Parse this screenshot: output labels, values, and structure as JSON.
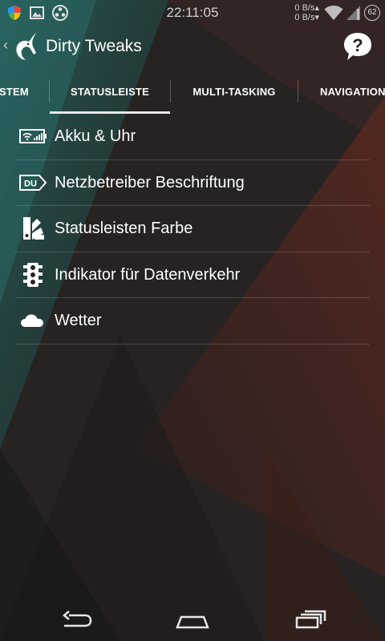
{
  "status_bar": {
    "time": "22:11:05",
    "net_up": "0 B/s",
    "net_down": "0 B/s",
    "battery": "62",
    "icons": [
      "shield-icon",
      "image-icon",
      "media-icon",
      "wifi-icon",
      "signal-icon",
      "battery-icon"
    ]
  },
  "action_bar": {
    "title": "Dirty Tweaks",
    "back_glyph": "‹",
    "help_icon": "help-icon"
  },
  "tabs": [
    {
      "label": "STEM"
    },
    {
      "label": "STATUSLEISTE",
      "selected": true
    },
    {
      "label": "MULTI-TASKING"
    },
    {
      "label": "NAVIGATION"
    }
  ],
  "list_items": [
    {
      "label": "Akku & Uhr",
      "icon": "battery-clock-icon"
    },
    {
      "label": "Netzbetreiber Beschriftung",
      "icon": "carrier-label-icon"
    },
    {
      "label": "Statusleisten Farbe",
      "icon": "color-palette-icon"
    },
    {
      "label": "Indikator für Datenverkehr",
      "icon": "traffic-light-icon"
    },
    {
      "label": "Wetter",
      "icon": "cloud-icon"
    }
  ],
  "nav_bar": {
    "icons": [
      "back-icon",
      "home-icon",
      "recents-icon"
    ]
  },
  "colors": {
    "accent_teal": "#1f6b68",
    "accent_red": "#7a2a1c",
    "background": "#262322",
    "text": "#ffffff"
  }
}
